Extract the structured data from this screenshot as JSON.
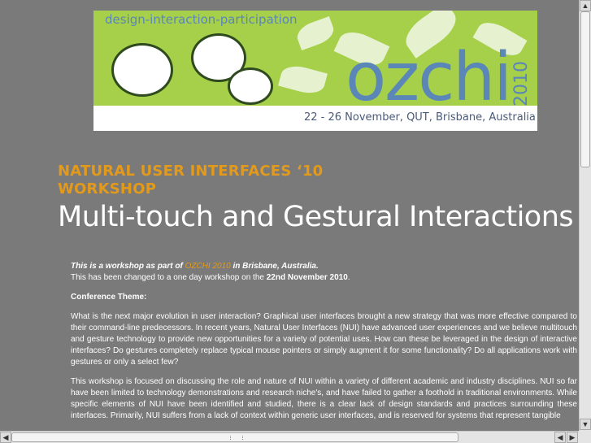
{
  "banner": {
    "tagline": "design-interaction-participation",
    "brand": "ozchi",
    "year": "2010",
    "dates": "22 - 26 November, QUT, Brisbane, Australia"
  },
  "heading": {
    "kicker_line1": "NATURAL USER INTERFACES ‘10",
    "kicker_line2": "WORKSHOP",
    "title": "Multi-touch and Gestural Interactions"
  },
  "content": {
    "intro_prefix": "This is a workshop as part of ",
    "intro_link": "OZCHI 2010",
    "intro_suffix": " in Brisbane, Australia.",
    "change_prefix": "This has been changed to a one day workshop on the ",
    "change_date": "22nd November 2010",
    "change_suffix": ".",
    "theme_heading": "Conference Theme:",
    "para1": "What is the next major evolution in user interaction? Graphical user interfaces brought a new strategy that was more effective compared to their command-line predecessors. In recent years, Natural User Interfaces (NUI) have advanced user experiences and we believe multitouch and gesture technology to provide new opportunities for a variety of potential uses. How can these be leveraged in the design of interactive interfaces? Do gestures completely replace typical mouse pointers or simply augment it for some functionality? Do all applications work with gestures or only a select few?",
    "para2": "This workshop is focused on discussing the role and nature of NUI within a variety of different academic and industry disciplines. NUI so far have been limited to technology demonstrations and research niche's, and have failed to gather a foothold in traditional environments. While specific elements of NUI have been identified and studied, there is a clear lack of design standards and practices surrounding these interfaces. Primarily, NUI suffers from a lack of context within generic user interfaces, and is reserved for systems that represent tangible"
  },
  "scrollbars": {
    "up_arrow": "▲",
    "down_arrow": "▼",
    "left_arrow": "◀",
    "right_arrow": "▶"
  },
  "colors": {
    "page_bg": "#7a7a7a",
    "accent_orange": "#e39a1a",
    "banner_green": "#a6cf4a",
    "banner_blue": "#5a86b8"
  }
}
